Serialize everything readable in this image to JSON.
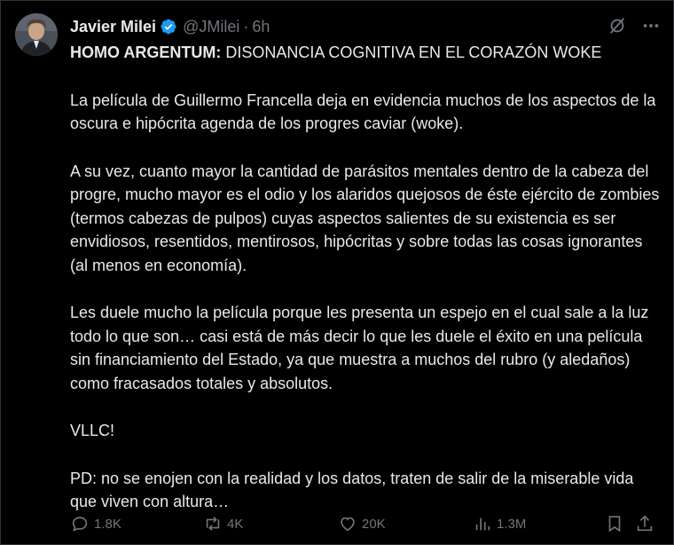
{
  "author": {
    "name": "Javier Milei",
    "handle": "@JMilei",
    "separator": "·",
    "time": "6h",
    "verified_color": "#1d9bf0"
  },
  "post": {
    "title_bold": "HOMO ARGENTUM:",
    "title_rest": " DISONANCIA COGNITIVA EN EL CORAZÓN WOKE",
    "paragraphs": [
      "La película de Guillermo Francella deja en evidencia muchos de los aspectos de la oscura e hipócrita agenda de los progres caviar (woke).",
      "A su vez, cuanto mayor la cantidad de parásitos mentales dentro de la cabeza del progre, mucho mayor es el odio y los alaridos quejosos de éste ejército de zombies (termos cabezas de pulpos) cuyas aspectos salientes de su existencia es ser envidiosos, resentidos, mentirosos, hipócritas y sobre todas las cosas ignorantes (al menos en economía).",
      "Les duele mucho la película porque les presenta un espejo en el cual sale a la luz todo lo que son… casi está de más decir lo que les duele el éxito en una película sin financiamiento del Estado, ya que muestra a muchos del rubro (y aledaños) como fracasados totales y absolutos.",
      "VLLC!",
      "PD: no se enojen con la realidad y los datos, traten de salir de la miserable vida que viven con altura…"
    ]
  },
  "actions": {
    "replies": "1.8K",
    "reposts": "4K",
    "likes": "20K",
    "views": "1.3M"
  },
  "icons": [
    "grok-icon",
    "more-icon",
    "reply-icon",
    "repost-icon",
    "like-icon",
    "views-icon",
    "bookmark-icon",
    "share-icon"
  ]
}
